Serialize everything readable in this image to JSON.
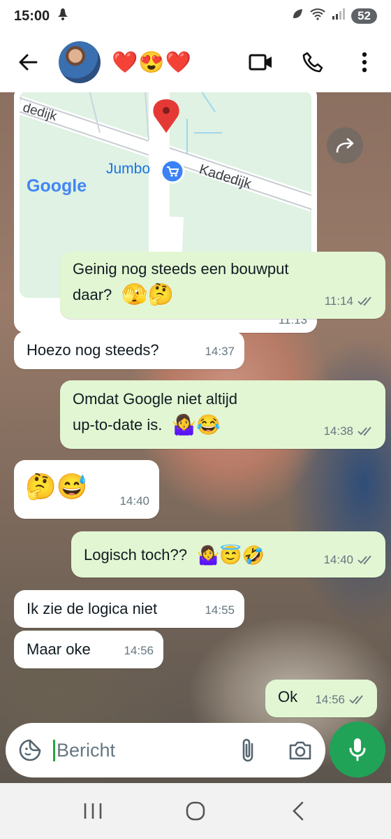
{
  "status_bar": {
    "time": "15:00",
    "battery": "52",
    "icons": [
      "notification-icon",
      "leaf-icon",
      "wifi-icon",
      "signal-icon"
    ]
  },
  "header": {
    "contact_name": "❤️😍❤️",
    "icons": [
      "back-arrow-icon",
      "video-call-icon",
      "phone-icon",
      "more-options-icon"
    ]
  },
  "map_message": {
    "labels": {
      "street_top": "dedijk",
      "place": "Jumbo",
      "street": "Kadedijk",
      "logo": "Google"
    },
    "time": "11:13"
  },
  "messages": [
    {
      "direction": "out",
      "text_line1": "Geinig nog steeds een bouwput",
      "text_line2": "daar?",
      "emoji": "🫣🤔",
      "time": "11:14",
      "read": true
    },
    {
      "direction": "in",
      "text": "Hoezo nog steeds?",
      "time": "14:37"
    },
    {
      "direction": "out",
      "text_line1": "Omdat Google niet altijd",
      "text_line2": "up-to-date is.",
      "emoji": "🤷‍♀️😂",
      "time": "14:38",
      "read": true
    },
    {
      "direction": "in",
      "emoji": "🤔😅",
      "time": "14:40"
    },
    {
      "direction": "out",
      "text": "Logisch toch??",
      "emoji": "🤷‍♀️😇🤣",
      "time": "14:40",
      "read": true
    },
    {
      "direction": "in",
      "text": "Ik zie de logica niet",
      "time": "14:55"
    },
    {
      "direction": "in",
      "text": "Maar oke",
      "time": "14:56"
    },
    {
      "direction": "out",
      "text": "Ok",
      "time": "14:56",
      "read": true
    }
  ],
  "composer": {
    "placeholder": "Bericht",
    "icons": [
      "sticker-icon",
      "attach-icon",
      "camera-icon",
      "mic-icon"
    ]
  },
  "nav_bar": {
    "icons": [
      "recent-apps-icon",
      "home-icon",
      "back-icon"
    ]
  },
  "colors": {
    "outgoing_bubble": "#e2f6d3",
    "incoming_bubble": "#ffffff",
    "accent_green": "#21a357",
    "read_ticks": "#667781"
  }
}
